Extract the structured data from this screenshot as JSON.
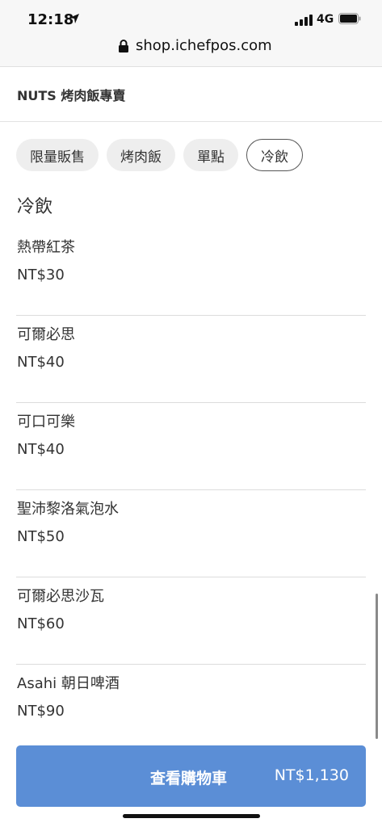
{
  "status_bar": {
    "time": "12:18",
    "network": "4G"
  },
  "browser": {
    "url": "shop.ichefpos.com"
  },
  "store": {
    "name": "NUTS 烤肉飯專賣"
  },
  "tabs": [
    {
      "label": "限量販售",
      "active": false
    },
    {
      "label": "烤肉飯",
      "active": false
    },
    {
      "label": "單點",
      "active": false
    },
    {
      "label": "冷飲",
      "active": true
    }
  ],
  "section": {
    "title": "冷飲",
    "items": [
      {
        "name": "熱帶紅茶",
        "price": "NT$30"
      },
      {
        "name": "可爾必思",
        "price": "NT$40"
      },
      {
        "name": "可口可樂",
        "price": "NT$40"
      },
      {
        "name": "聖沛黎洛氣泡水",
        "price": "NT$50"
      },
      {
        "name": "可爾必思沙瓦",
        "price": "NT$60"
      },
      {
        "name": "Asahi 朝日啤酒",
        "price": "NT$90"
      }
    ]
  },
  "cart": {
    "label": "查看購物車",
    "total": "NT$1,130"
  },
  "colors": {
    "cart_button": "#5b8ed6",
    "tab_bg": "#eeeeee",
    "active_tab_border": "#555555"
  }
}
